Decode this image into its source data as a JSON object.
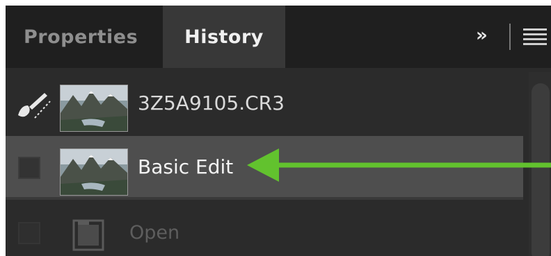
{
  "tabs": {
    "properties_label": "Properties",
    "history_label": "History"
  },
  "header_icons": {
    "expand": "»",
    "menu": "hamburger-menu-icon"
  },
  "history": {
    "items": [
      {
        "label": "3Z5A9105.CR3",
        "icon": "brush-icon",
        "state": "source"
      },
      {
        "label": "Basic Edit",
        "icon": "checkbox",
        "state": "selected"
      },
      {
        "label": "Open",
        "icon": "folder-icon",
        "state": "dimmed"
      }
    ]
  },
  "colors": {
    "arrow": "#62c22e",
    "panel": "#2b2b2b",
    "selected_row": "#4e4e4e"
  }
}
